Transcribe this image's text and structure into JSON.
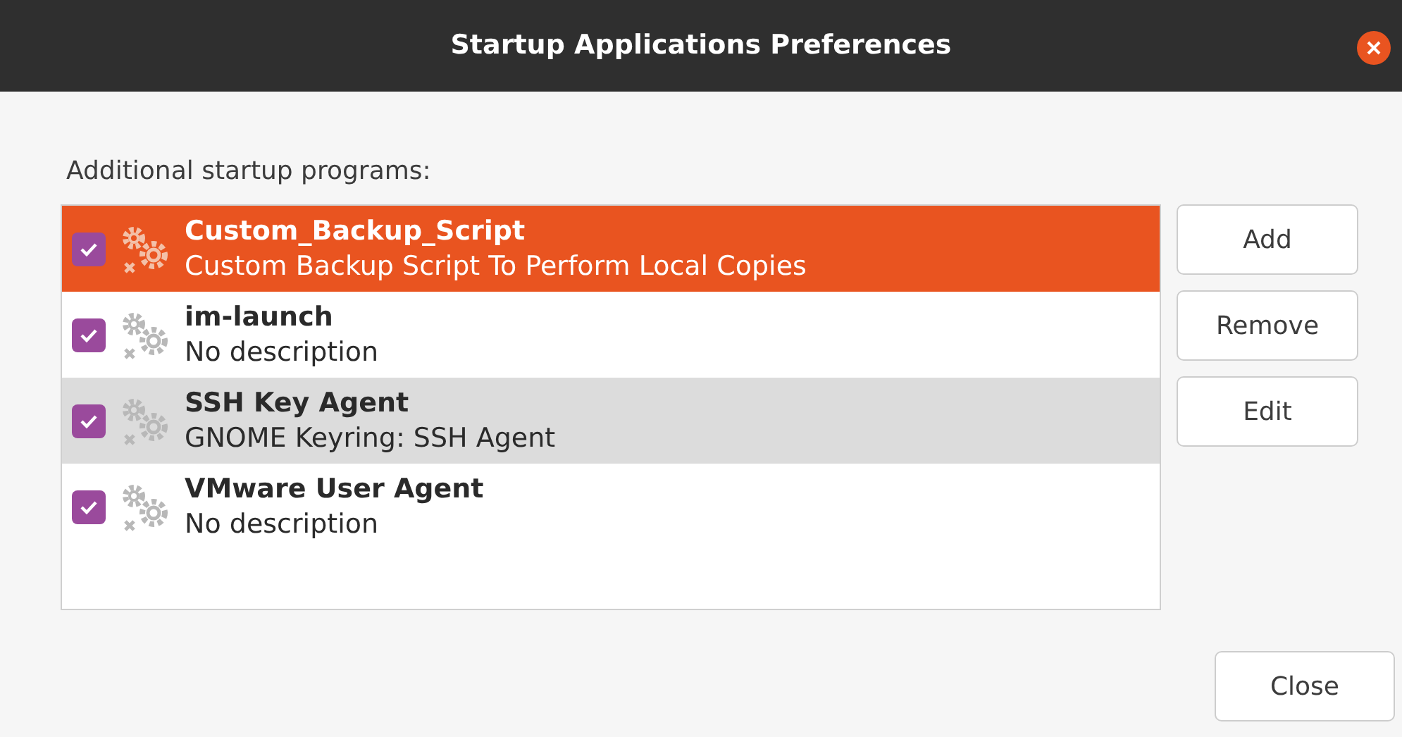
{
  "window": {
    "title": "Startup Applications Preferences"
  },
  "list_label": "Additional startup programs:",
  "programs": [
    {
      "name": "Custom_Backup_Script",
      "description": "Custom Backup Script To Perform Local Copies",
      "checked": true,
      "selected": true,
      "hovered": false
    },
    {
      "name": "im-launch",
      "description": "No description",
      "checked": true,
      "selected": false,
      "hovered": false
    },
    {
      "name": "SSH Key Agent",
      "description": "GNOME Keyring: SSH Agent",
      "checked": true,
      "selected": false,
      "hovered": true
    },
    {
      "name": "VMware User Agent",
      "description": "No description",
      "checked": true,
      "selected": false,
      "hovered": false
    }
  ],
  "side_buttons": [
    "Add",
    "Remove",
    "Edit"
  ],
  "close_button": "Close"
}
